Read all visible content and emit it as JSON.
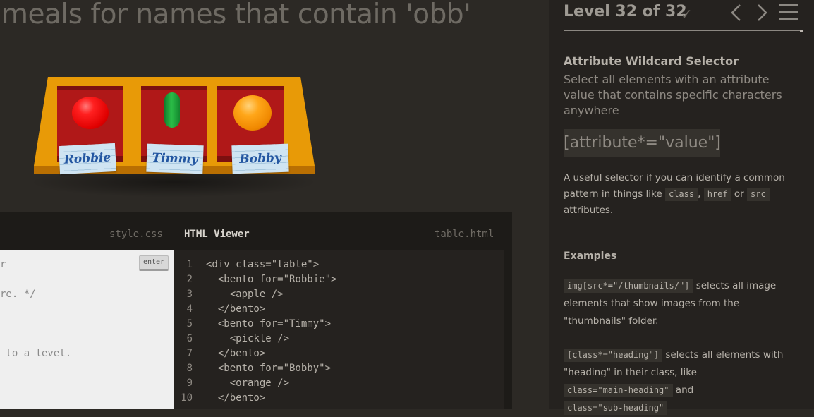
{
  "instruction": "meals for names that contain 'obb'",
  "table": {
    "bentos": [
      {
        "food": "apple",
        "name": "Robbie",
        "food_color": "#ff2020"
      },
      {
        "food": "pickle",
        "name": "Timmy",
        "food_color": "#2bbd47"
      },
      {
        "food": "orange",
        "name": "Bobby",
        "food_color": "#ffa619"
      }
    ]
  },
  "editor": {
    "css_tab": "style.css",
    "html_tab": "HTML Viewer",
    "html_file": "table.html",
    "enter_label": "enter",
    "css_lines": [
      "r",
      "re. */",
      " to a level."
    ],
    "line_numbers": [
      "1",
      "2",
      "3",
      "4",
      "5",
      "6",
      "7",
      "8",
      "9",
      "10"
    ],
    "html_lines": [
      "<div class=\"table\">",
      "  <bento for=\"Robbie\">",
      "    <apple />",
      "  </bento>",
      "  <bento for=\"Timmy\">",
      "    <pickle />",
      "  </bento>",
      "  <bento for=\"Bobby\">",
      "    <orange />",
      "  </bento>"
    ]
  },
  "sidebar": {
    "level_label": "Level 32 of 32",
    "progress": 1.0,
    "selector_name": "Attribute Wildcard Selector",
    "selector_desc": "Select all elements with an attribute value that contains specific characters anywhere",
    "syntax": "[attribute*=\"value\"]",
    "hint_before": "A useful selector if you can identify a common pattern in things like",
    "hint_tags": [
      "class",
      "href",
      "src"
    ],
    "hint_sep_1": ",",
    "hint_sep_2": "or",
    "hint_after": "attributes.",
    "examples_heading": "Examples",
    "example_1_code": "img[src*=\"/thumbnails/\"]",
    "example_1_text": "selects all image elements that show images from the \"thumbnails\" folder.",
    "example_2_code": "[class*=\"heading\"]",
    "example_2_text_a": "selects all elements with \"heading\" in their class, like",
    "example_2_code_b": "class=\"main-heading\"",
    "example_2_and": "and",
    "example_2_code_c": "class=\"sub-heading\""
  },
  "colors": {
    "background": "#2c2925",
    "table": "#e89a07",
    "bento": "#b01818",
    "sidebar": "#25221f"
  }
}
